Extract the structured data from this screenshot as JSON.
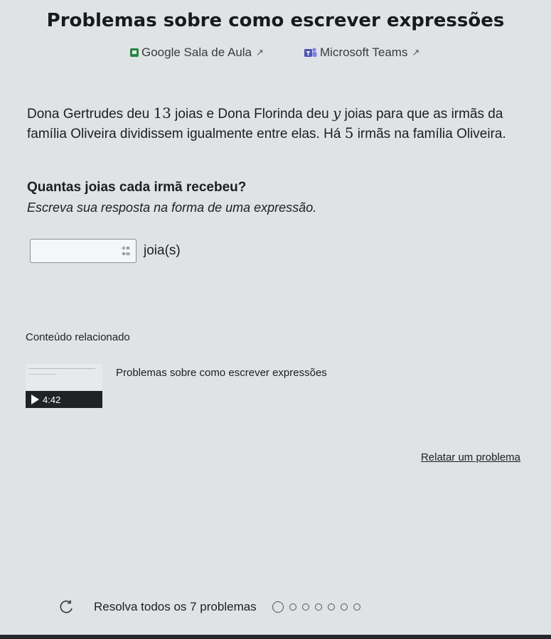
{
  "title": "Problemas sobre como escrever expressões",
  "share": {
    "classroom_label": "Google Sala de Aula",
    "teams_label": "Microsoft Teams",
    "external_icon": "external-link-icon"
  },
  "problem": {
    "part1": "Dona Gertrudes deu ",
    "num1": "13",
    "part2": " joias e Dona Florinda deu ",
    "var1": "y",
    "part3": " joias para que as irmãs da família Oliveira dividissem igualmente entre elas. Há ",
    "num2": "5",
    "part4": " irmãs na família Oliveira."
  },
  "question": "Quantas joias cada irmã recebeu?",
  "instruction": "Escreva sua resposta na forma de uma expressão.",
  "answer": {
    "value": "",
    "keypad_symbol_top": "÷×",
    "keypad_symbol_bottom": "+=",
    "unit": "joia(s)"
  },
  "related": {
    "heading": "Conteúdo relacionado",
    "video_title": "Problemas sobre como escrever expressões",
    "duration": "4:42"
  },
  "report_link": "Relatar um problema",
  "progress": {
    "label": "Resolva todos os 7 problemas",
    "total": 7,
    "completed": 0
  },
  "colors": {
    "background": "#dfe3e6",
    "classroom_green": "#1f8a3c",
    "teams_purple": "#4b53bc",
    "duration_bar": "#1f2326"
  }
}
